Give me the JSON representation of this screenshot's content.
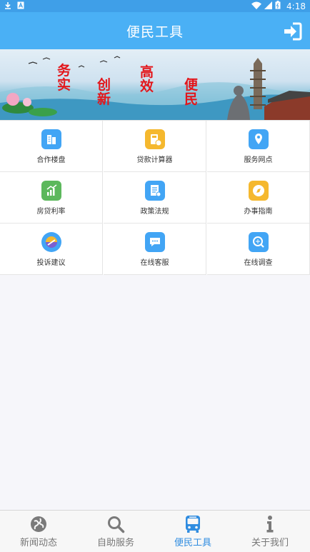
{
  "status": {
    "time": "4:18"
  },
  "appbar": {
    "title": "便民工具"
  },
  "banner": {
    "calligraphy": [
      "务",
      "实",
      "创",
      "新",
      "高",
      "效",
      "便",
      "民"
    ]
  },
  "tools": [
    {
      "label": "合作楼盘",
      "icon": "building-icon",
      "color": "#42a5f5"
    },
    {
      "label": "贷款计算器",
      "icon": "calculator-icon",
      "color": "#f5b82e"
    },
    {
      "label": "服务网点",
      "icon": "location-pin-icon",
      "color": "#42a5f5"
    },
    {
      "label": "房贷利率",
      "icon": "rate-chart-icon",
      "color": "#5cb85c"
    },
    {
      "label": "政策法规",
      "icon": "document-icon",
      "color": "#42a5f5"
    },
    {
      "label": "办事指南",
      "icon": "compass-icon",
      "color": "#f5b82e"
    },
    {
      "label": "投诉建议",
      "icon": "feedback-icon",
      "color": "#42a5f5"
    },
    {
      "label": "在线客服",
      "icon": "chat-icon",
      "color": "#42a5f5"
    },
    {
      "label": "在线调查",
      "icon": "survey-icon",
      "color": "#42a5f5"
    }
  ],
  "tabs": [
    {
      "label": "新闻动态",
      "icon": "globe-icon",
      "active": false
    },
    {
      "label": "自助服务",
      "icon": "search-icon",
      "active": false
    },
    {
      "label": "便民工具",
      "icon": "bus-icon",
      "active": true
    },
    {
      "label": "关于我们",
      "icon": "info-icon",
      "active": false
    }
  ],
  "colors": {
    "primary": "#4ab0f5",
    "active_tab": "#2f8ce0",
    "calligraphy": "#e3161b"
  }
}
